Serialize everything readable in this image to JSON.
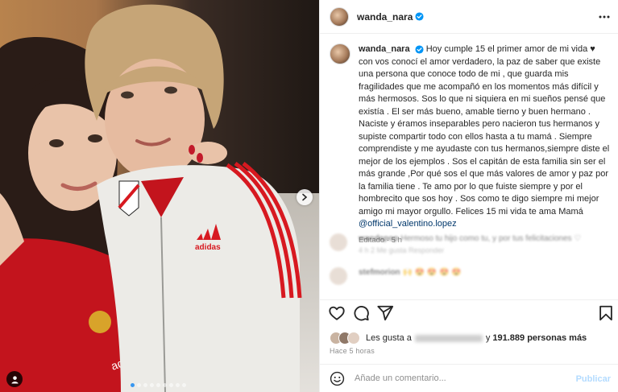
{
  "post": {
    "username": "wanda_nara",
    "verified": true
  },
  "photo": {
    "carousel_total": 9,
    "carousel_active": 1,
    "shirt_logo_text": "adidas"
  },
  "caption": {
    "username": "wanda_nara",
    "text": " Hoy cumple 15 el primer amor de mi vida ♥ con vos conocí el amor verdadero, la paz de saber que existe una persona que conoce todo de mi , que guarda mis fragilidades que me acompañó en los momentos más difícil y más hermosos. Sos lo que ni siquiera en mi sueños pensé que existía . El ser más bueno, amable tierno y buen hermano . Naciste y éramos inseparables pero nacieron tus hermanos y supiste compartir todo con ellos hasta a tu mamá . Siempre comprendiste y me ayudaste con tus hermanos,siempre diste el mejor de los ejemplos . Sos el capitán de esta familia sin ser el más grande ,Por qué sos el que más valores de amor y paz por la familia tiene . Te amo por lo que fuiste siempre y por el hombrecito que sos hoy . Sos como te digo siempre mi mejor amigo mi mayor orgullo. Felices 15 mi vida te ama Mamá ",
    "mention": "@official_valentino.lopez",
    "edited": "Editado · 5 h"
  },
  "comments": [
    {
      "user": "wandapop",
      "text": "Hermoso tu hijo como tu, y por tus felicitaciones ♡",
      "meta": "4 h   2 Me gusta   Responder"
    },
    {
      "user": "stefmorion",
      "text": "🙌 😍 😍 😍 😍",
      "meta": ""
    }
  ],
  "likes": {
    "prefix": "Les gusta a",
    "connector": "y",
    "count_text": "191.889 personas más"
  },
  "time_ago": "Hace 5 horas",
  "comment_box": {
    "placeholder": "Añade un comentario...",
    "publish_label": "Publicar"
  },
  "colors": {
    "accent": "#0095f6",
    "publish_disabled": "#b3dbff",
    "muted": "#8e8e8e",
    "river_red": "#d71920"
  },
  "icons": {
    "more": "more-horizontal-icon",
    "like": "heart-icon",
    "comment": "comment-icon",
    "share": "share-icon",
    "save": "bookmark-icon",
    "emoji": "emoji-icon",
    "tag": "user-tag-icon",
    "next": "chevron-right-icon",
    "verified": "verified-badge-icon"
  }
}
